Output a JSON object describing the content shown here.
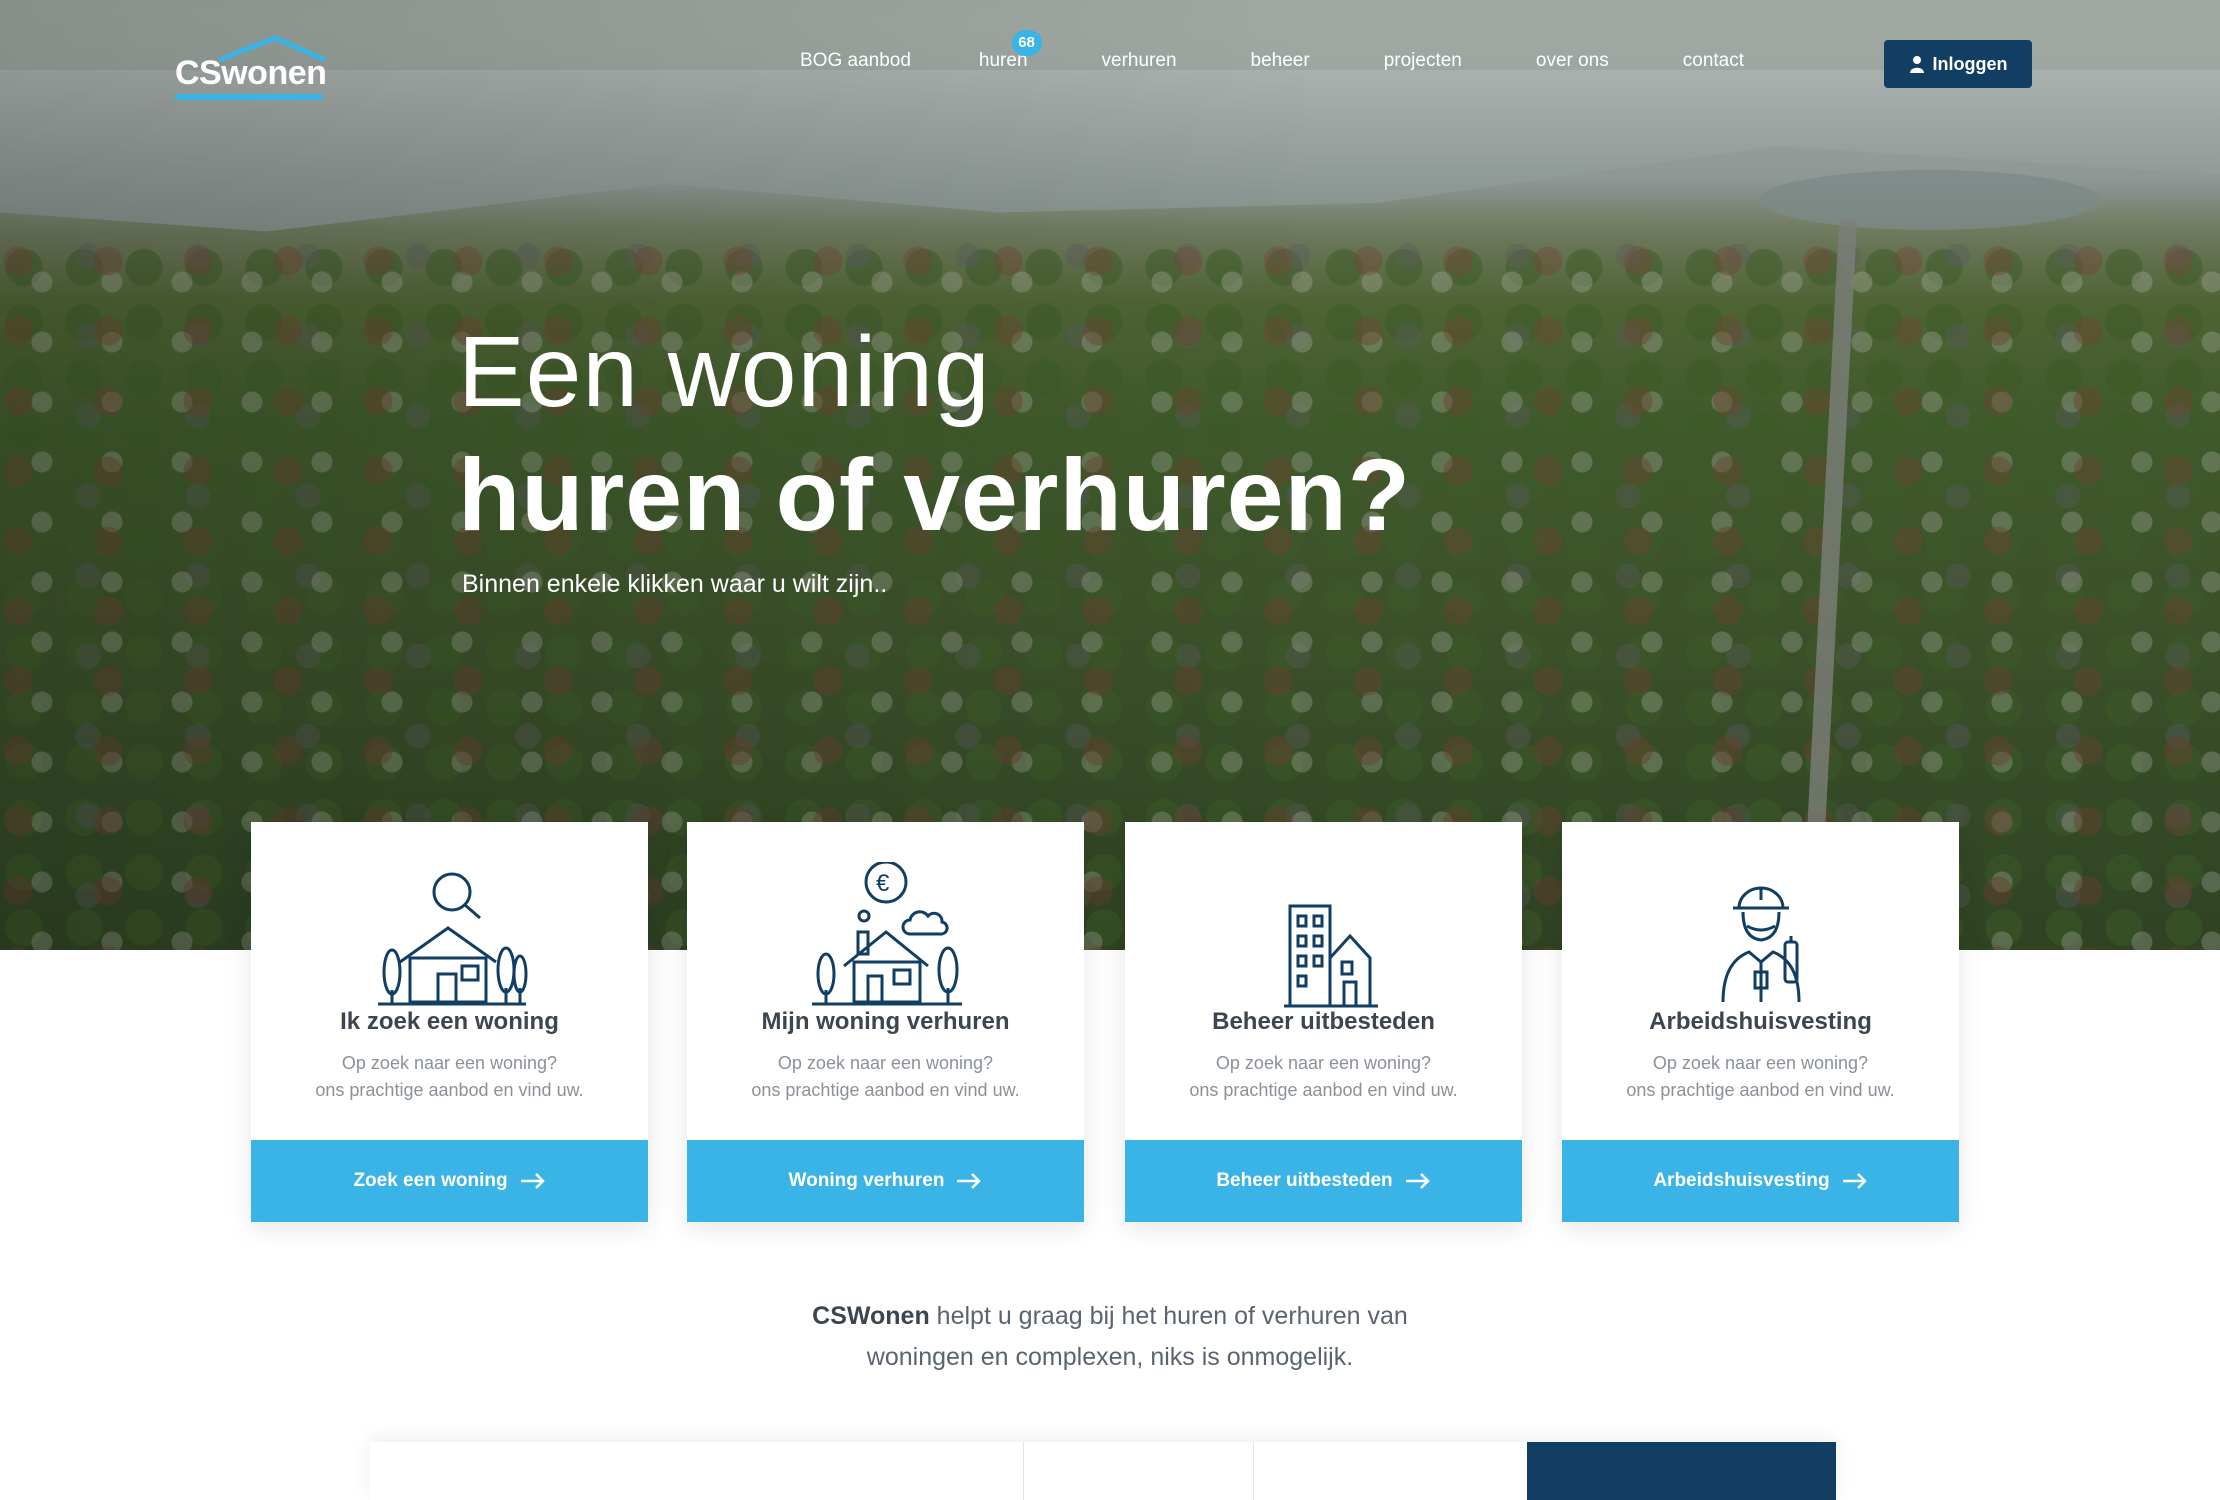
{
  "brand": {
    "name": "CSwonen",
    "accent": "#3ab4e6",
    "dark": "#123e63"
  },
  "nav": {
    "items": [
      {
        "label": "BOG aanbod"
      },
      {
        "label": "huren",
        "badge": "68"
      },
      {
        "label": "verhuren"
      },
      {
        "label": "beheer"
      },
      {
        "label": "projecten"
      },
      {
        "label": "over ons"
      },
      {
        "label": "contact"
      }
    ],
    "login_label": "Inloggen",
    "login_icon": "user-icon"
  },
  "hero": {
    "line1": "Een woning",
    "line2": "huren of verhuren?",
    "subtitle": "Binnen enkele klikken waar u wilt zijn.."
  },
  "cards": [
    {
      "icon": "house-search-icon",
      "title": "Ik zoek een woning",
      "text1": "Op zoek naar een woning?",
      "text2": "ons prachtige aanbod en vind uw.",
      "button": "Zoek een woning"
    },
    {
      "icon": "house-euro-icon",
      "title": "Mijn woning verhuren",
      "text1": "Op zoek naar een woning?",
      "text2": "ons prachtige aanbod en vind uw.",
      "button": "Woning verhuren"
    },
    {
      "icon": "building-icon",
      "title": "Beheer uitbesteden",
      "text1": "Op zoek naar een woning?",
      "text2": "ons prachtige aanbod en vind uw.",
      "button": "Beheer uitbesteden"
    },
    {
      "icon": "worker-icon",
      "title": "Arbeidshuisvesting",
      "text1": "Op zoek naar een woning?",
      "text2": "ons prachtige aanbod en vind uw.",
      "button": "Arbeidshuisvesting"
    }
  ],
  "intro": {
    "brand": "CSWonen",
    "line1_rest": " helpt u graag bij het huren of verhuren van",
    "line2": "woningen en complexen, niks is onmogelijk."
  }
}
